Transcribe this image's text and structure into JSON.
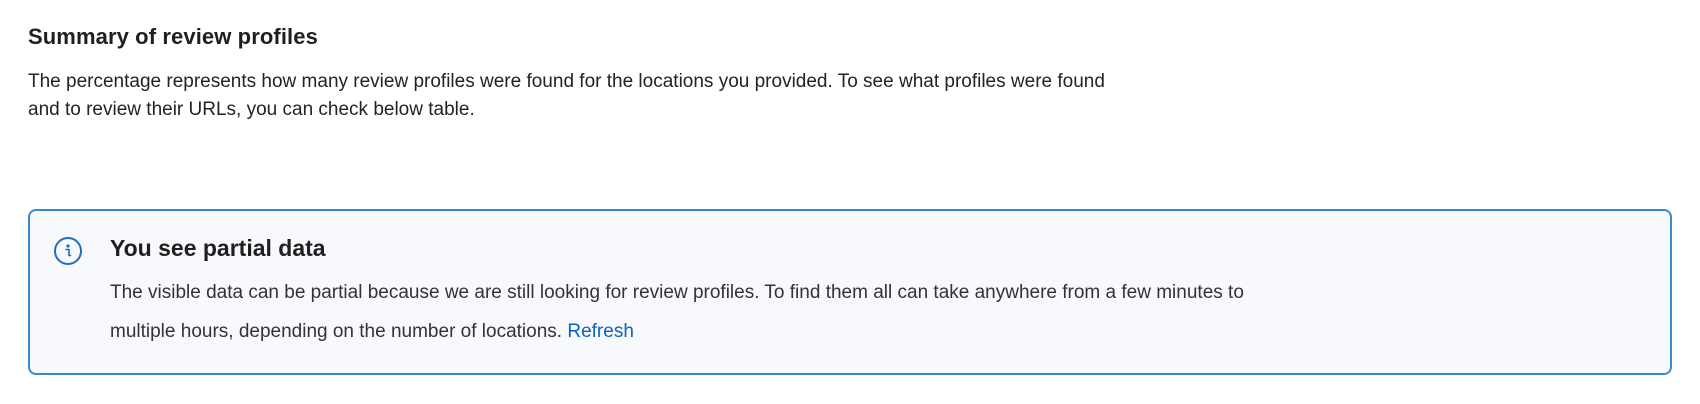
{
  "summary": {
    "title": "Summary of review profiles",
    "description": "The percentage represents how many review profiles were found for the locations you provided. To see what profiles were found and to review their URLs, you can check below table."
  },
  "notice": {
    "icon": "info-icon",
    "title": "You see partial data",
    "body": "The visible data can be partial because we are still looking for review profiles. To find them all can take anywhere from a few minutes to multiple hours, depending on the number of locations.",
    "link_label": "Refresh",
    "border_color": "#3a8ad1",
    "link_color": "#0a63c2"
  }
}
